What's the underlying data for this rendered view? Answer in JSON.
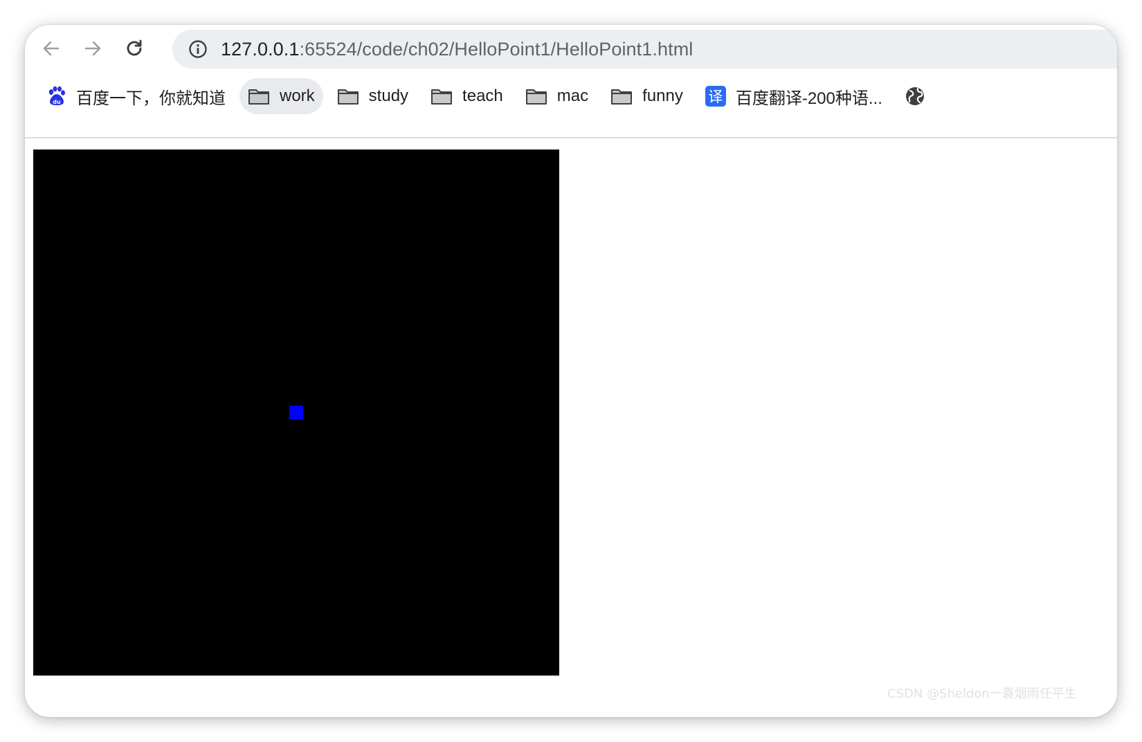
{
  "browser": {
    "address_bar": {
      "host": "127.0.0.1",
      "path": ":65524/code/ch02/HelloPoint1/HelloPoint1.html"
    },
    "bookmarks": [
      {
        "label": "百度一下，你就知道",
        "icon": "baidu-paw-icon"
      },
      {
        "label": "work",
        "icon": "folder-icon"
      },
      {
        "label": "study",
        "icon": "folder-icon"
      },
      {
        "label": "teach",
        "icon": "folder-icon"
      },
      {
        "label": "mac",
        "icon": "folder-icon"
      },
      {
        "label": "funny",
        "icon": "folder-icon"
      },
      {
        "label": "百度翻译-200种语...",
        "icon": "translate-icon"
      },
      {
        "label": "",
        "icon": "globe-icon"
      }
    ],
    "translate_icon_glyph": "译"
  },
  "page": {
    "canvas_background": "#000000",
    "point_color": "#0000ff"
  },
  "watermark": "CSDN @Sheldon一蓑烟雨任平生"
}
